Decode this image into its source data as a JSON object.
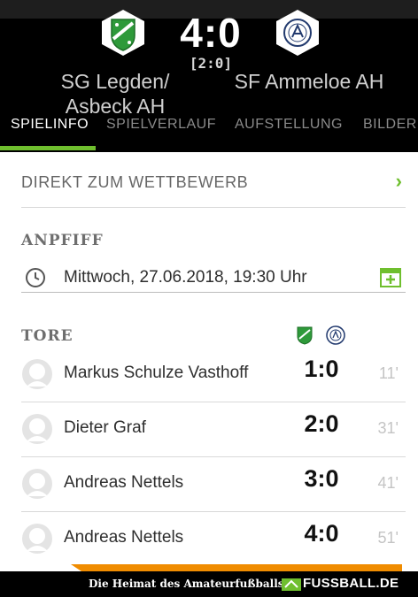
{
  "match": {
    "score": "4:0",
    "halftime": "[2:0]",
    "home_team": "SG Legden/ Asbeck AH",
    "away_team": "SF Ammeloe AH",
    "home_crest_icon": "green-club-crest",
    "away_crest_icon": "white-club-crest"
  },
  "tabs": [
    {
      "label": "SPIELINFO",
      "active": true
    },
    {
      "label": "SPIELVERLAUF",
      "active": false
    },
    {
      "label": "AUFSTELLUNG",
      "active": false
    },
    {
      "label": "BILDER",
      "active": false
    }
  ],
  "competition_link": {
    "label": "DIREKT ZUM WETTBEWERB",
    "icon": "chevron-right-icon"
  },
  "kickoff": {
    "title": "ANPFIFF",
    "datetime": "Mittwoch, 27.06.2018, 19:30 Uhr",
    "icon": "clock-icon",
    "action_icon": "add-to-calendar-icon"
  },
  "goals": {
    "title": "TORE",
    "items": [
      {
        "player": "Markus Schulze Vasthoff",
        "score": "1:0",
        "minute": "11'"
      },
      {
        "player": "Dieter Graf",
        "score": "2:0",
        "minute": "31'"
      },
      {
        "player": "Andreas Nettels",
        "score": "3:0",
        "minute": "41'"
      },
      {
        "player": "Andreas Nettels",
        "score": "4:0",
        "minute": "51'"
      }
    ]
  },
  "footer": {
    "tagline": "Die Heimat des Amateurfußballs",
    "brand": "FUSSBALL.DE"
  },
  "colors": {
    "accent_green": "#6fbf2e",
    "header_bg": "#000000",
    "accent_orange": "#f08c00"
  }
}
